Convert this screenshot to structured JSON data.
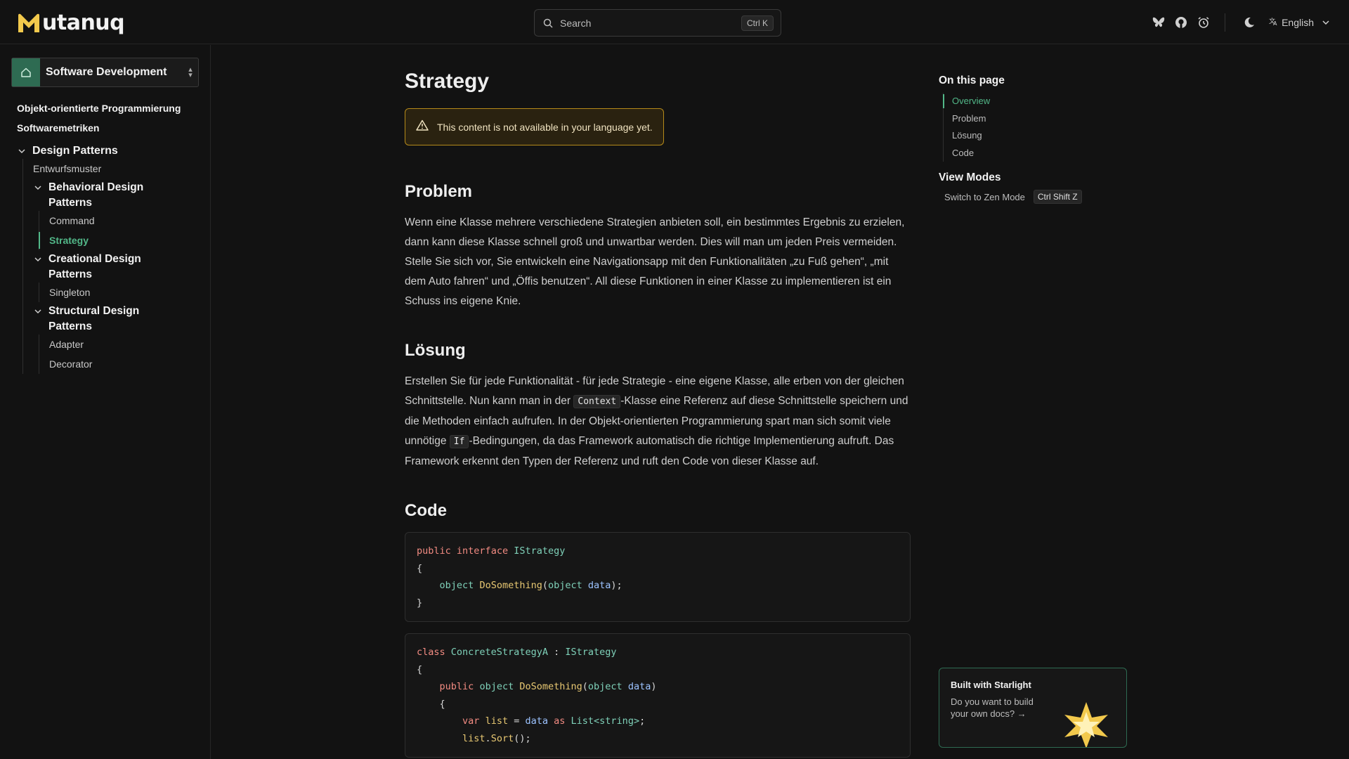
{
  "header": {
    "logo_text": "utanuq",
    "search_placeholder": "Search",
    "search_shortcut": "Ctrl K",
    "icons": [
      "bluesky-icon",
      "github-icon",
      "alarm-icon",
      "moon-icon"
    ],
    "language": "English"
  },
  "sidebar": {
    "section_label": "Software Development",
    "top_items": [
      "Objekt-orientierte Programmierung",
      "Softwaremetriken"
    ],
    "group": {
      "title": "Design Patterns",
      "intro": "Entwurfsmuster",
      "subgroups": [
        {
          "title": "Behavioral Design Patterns",
          "items": [
            "Command",
            "Strategy"
          ]
        },
        {
          "title": "Creational Design Patterns",
          "items": [
            "Singleton"
          ]
        },
        {
          "title": "Structural Design Patterns",
          "items": [
            "Adapter",
            "Decorator"
          ]
        }
      ]
    },
    "active_item": "Strategy"
  },
  "content": {
    "title": "Strategy",
    "notice": "This content is not available in your language yet.",
    "problem": {
      "heading": "Problem",
      "text": "Wenn eine Klasse mehrere verschiedene Strategien anbieten soll, ein bestimmtes Ergebnis zu erzielen, dann kann diese Klasse schnell groß und unwartbar werden. Dies will man um jeden Preis vermeiden. Stelle Sie sich vor, Sie entwickeln eine Navigationsapp mit den Funktionalitäten „zu Fuß gehen“, „mit dem Auto fahren“ und „Öffis benutzen“. All diese Funktionen in einer Klasse zu implementieren ist ein Schuss ins eigene Knie."
    },
    "loesung": {
      "heading": "Lösung",
      "text_1": "Erstellen Sie für jede Funktionalität - für jede Strategie - eine eigene Klasse, alle erben von der gleichen Schnittstelle. Nun kann man in der ",
      "code_1": "Context",
      "text_2": "-Klasse eine Referenz auf diese Schnittstelle speichern und die Methoden einfach aufrufen. In der Objekt-orientierten Programmierung spart man sich somit viele unnötige ",
      "code_2": "If",
      "text_3": "-Bedingungen, da das Framework automatisch die richtige Implementierung aufruft. Das Framework erkennt den Typen der Referenz und ruft den Code von dieser Klasse auf."
    },
    "code": {
      "heading": "Code",
      "block1": {
        "l1_kw1": "public",
        "l1_kw2": "interface",
        "l1_ty": "IStrategy",
        "l2": "{",
        "l3_ty": "object",
        "l3_fn": "DoSomething",
        "l3_open": "(",
        "l3_pty": "object",
        "l3_pn": "data",
        "l3_close": ");",
        "l4": "}"
      },
      "block2": {
        "l1_kw": "class",
        "l1_ty": "ConcreteStrategyA",
        "l1_sep": " : ",
        "l1_base": "IStrategy",
        "l2": "{",
        "l3_kw": "public",
        "l3_ty": "object",
        "l3_fn": "DoSomething",
        "l3_open": "(",
        "l3_pty": "object",
        "l3_pn": "data",
        "l3_close": ")",
        "l4": "{",
        "l5_kw": "var",
        "l5_var": "list",
        "l5_eq": " = ",
        "l5_pn": "data",
        "l5_as": "as",
        "l5_ty": "List",
        "l5_gen": "<string>",
        "l5_end": ";",
        "l6_var": "list",
        "l6_dot": ".",
        "l6_fn": "Sort",
        "l6_end": "();"
      }
    }
  },
  "toc": {
    "title": "On this page",
    "items": [
      "Overview",
      "Problem",
      "Lösung",
      "Code"
    ],
    "active": "Overview",
    "view_modes_title": "View Modes",
    "zen_label": "Switch to Zen Mode",
    "zen_shortcut": "Ctrl Shift Z"
  },
  "starlight": {
    "title": "Built with Starlight",
    "text": "Do you want to build your own docs? →"
  },
  "colors": {
    "accent": "#52b788",
    "background": "#121212",
    "caution_border": "#b58a1a",
    "logo_gold": "#f2c94c"
  }
}
